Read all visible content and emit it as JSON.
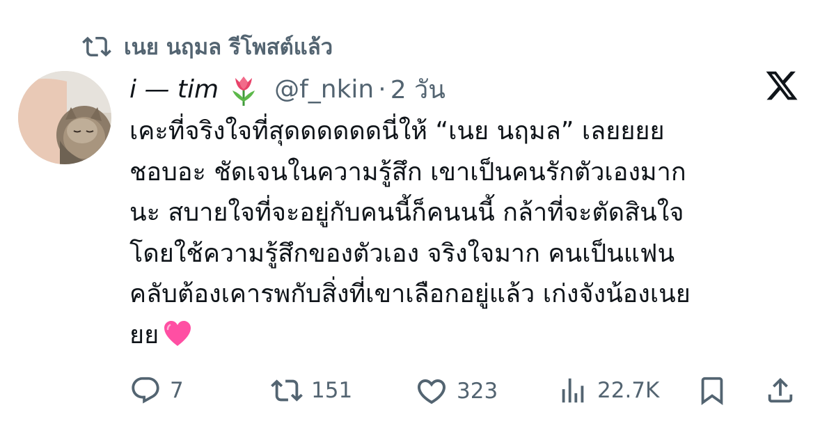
{
  "repost_banner": {
    "icon": "repost-icon",
    "text": "เนย นฤมล รีโพสต์แล้ว"
  },
  "author": {
    "display_name": "i — tim",
    "name_emoji": "tulip",
    "handle": "@f_nkin",
    "separator": "·",
    "time": "2 วัน",
    "avatar": "cat-avatar"
  },
  "platform_logo": "x-logo-icon",
  "tweet": {
    "text": "เคะที่จริงใจที่สุดดดดดดนี่ให้ “เนย นฤมล” เลยยยย\nชอบอะ ชัดเจนในความรู้สึก เขาเป็นคนรักตัวเองมาก\nนะ สบายใจที่จะอยู่กับคนนี้ก็คนนนี้ กล้าที่จะตัดสินใจ\nโดยใช้ความรู้สึกของตัวเอง จริงใจมาก คนเป็นแฟน\nคลับต้องเคารพกับสิ่งที่เขาเลือกอยู่แล้ว เก่งจังน้องเนย\nยย",
    "trailing_emoji": "pink-heart"
  },
  "actions": {
    "replies": "7",
    "reposts": "151",
    "likes": "323",
    "views": "22.7K"
  },
  "colors": {
    "text": "#0f1419",
    "secondary": "#536471",
    "heart": "#ff4fa3",
    "tulip": "#e8436a"
  }
}
